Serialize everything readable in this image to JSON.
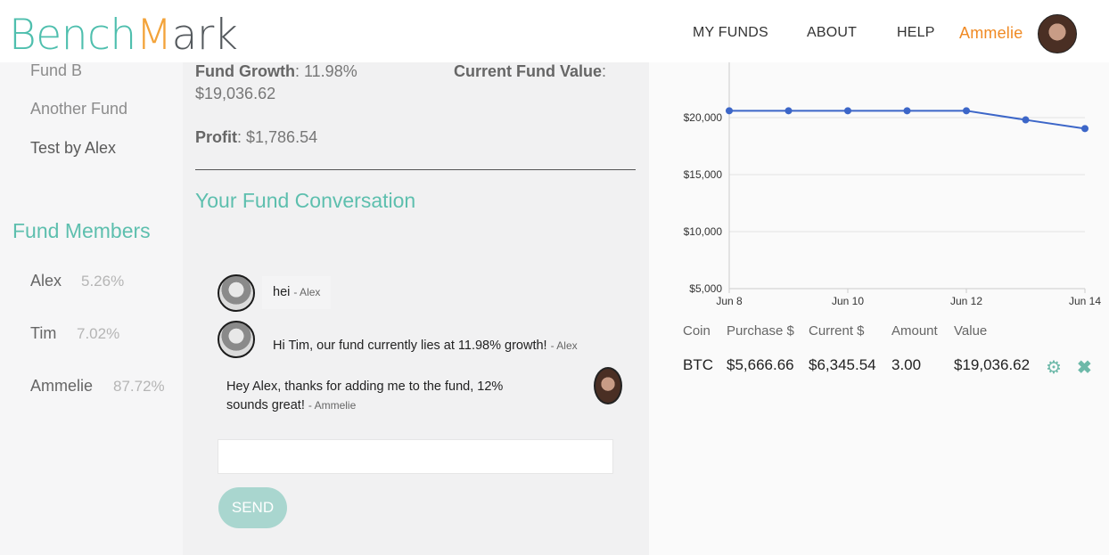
{
  "brand": {
    "part1": "Bench",
    "part2": "M",
    "part3": "ark"
  },
  "nav": {
    "my_funds": "MY FUNDS",
    "about": "ABOUT",
    "help": "HELP",
    "user": "Ammelie"
  },
  "sidebar": {
    "funds": [
      "Fund B",
      "Another Fund",
      "Test by Alex"
    ],
    "members_title": "Fund Members",
    "members": [
      {
        "name": "Alex",
        "pct": "5.26%"
      },
      {
        "name": "Tim",
        "pct": "7.02%"
      },
      {
        "name": "Ammelie",
        "pct": "87.72%"
      }
    ]
  },
  "fund": {
    "growth_label": "Fund Growth",
    "growth_value": "11.98%",
    "current_label": "Current Fund Value",
    "current_value": "$19,036.62",
    "profit_label": "Profit",
    "profit_value": "$1,786.54"
  },
  "conversation": {
    "title": "Your Fund Conversation",
    "messages": [
      {
        "text": "hei",
        "author": "- Alex"
      },
      {
        "text": "Hi Tim, our fund currently lies at 11.98% growth!",
        "author": "- Alex"
      },
      {
        "text_line1": "Hey Alex, thanks for adding me to the fund, 12%",
        "text_line2": "sounds great!",
        "author": "- Ammelie"
      }
    ],
    "input_placeholder": "",
    "send_label": "SEND"
  },
  "chart_data": {
    "type": "line",
    "x": [
      "Jun 8",
      "Jun 9",
      "Jun 10",
      "Jun 11",
      "Jun 12",
      "Jun 13",
      "Jun 14"
    ],
    "x_tick_labels": [
      "Jun 8",
      "Jun 10",
      "Jun 12",
      "Jun 14"
    ],
    "series": [
      {
        "values": [
          20600,
          20600,
          20600,
          20600,
          20600,
          19800,
          19036.62
        ]
      }
    ],
    "y_ticks": [
      5000,
      10000,
      15000,
      20000
    ],
    "y_tick_labels": [
      "$5,000",
      "$10,000",
      "$15,000",
      "$20,000"
    ],
    "ylim": [
      5000,
      22500
    ],
    "grid": true,
    "color": "#3c66c8"
  },
  "holdings": {
    "headers": [
      "Coin",
      "Purchase $",
      "Current $",
      "Amount",
      "Value"
    ],
    "rows": [
      {
        "coin": "BTC",
        "purchase": "$5,666.66",
        "current": "$6,345.54",
        "amount": "3.00",
        "value": "$19,036.62"
      }
    ]
  },
  "icons": {
    "settings": "gear-icon",
    "delete": "close-icon"
  },
  "colors": {
    "accent": "#5dbfae",
    "brand_orange": "#f3a33a",
    "user_orange": "#f08a24",
    "send": "#a9d6cf"
  }
}
